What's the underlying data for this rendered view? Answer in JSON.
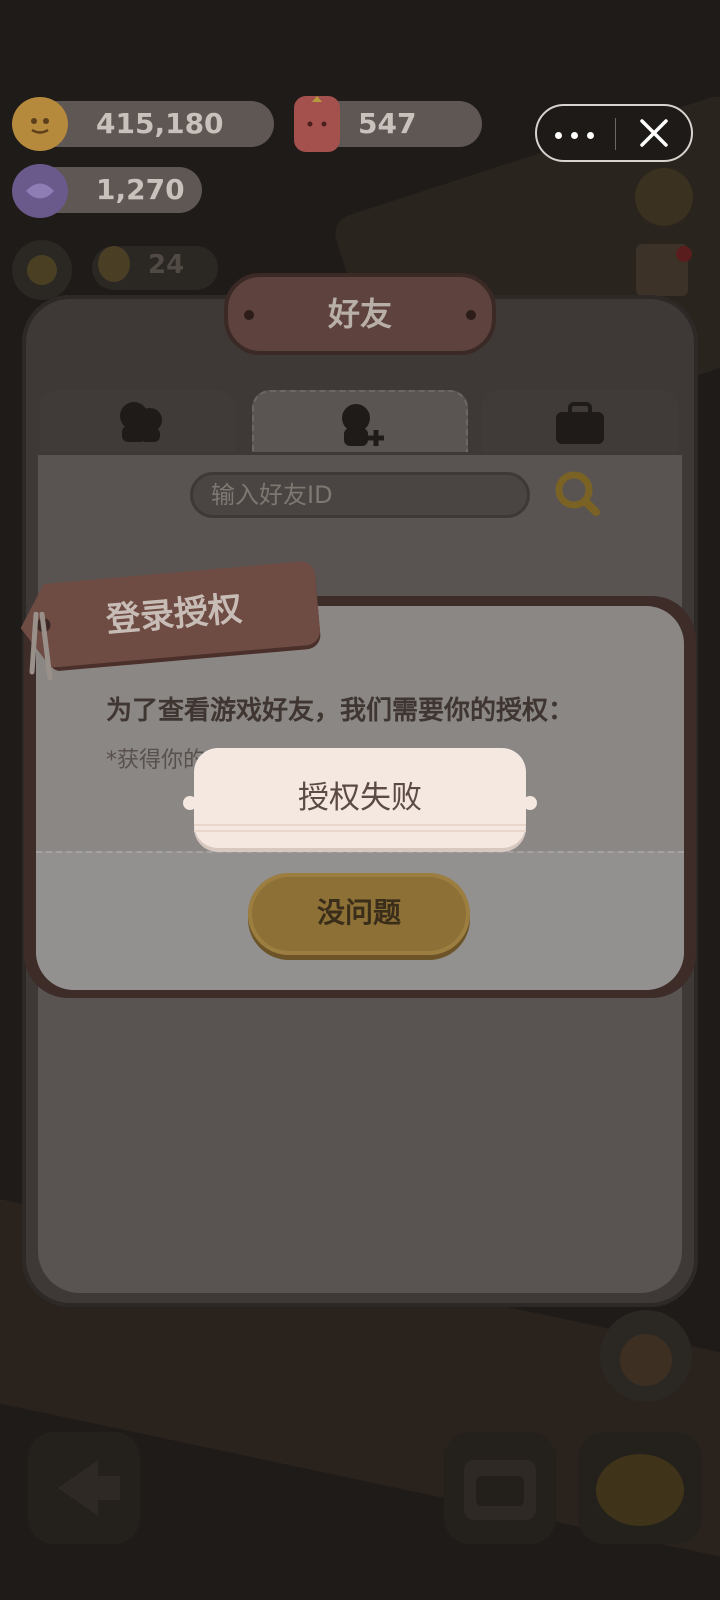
{
  "currency": {
    "coins": "415,180",
    "candy": "547",
    "gems": "1,270",
    "ducks": "24"
  },
  "colors": {
    "accent_gold": "#8d7036",
    "panel": "#3e3936",
    "toast_bg": "#f4e8e1",
    "tag_brown": "#6e4b43"
  },
  "friends_panel": {
    "title": "好友",
    "tabs": [
      {
        "name": "friends-list",
        "icon": "friends-icon"
      },
      {
        "name": "add-friend",
        "icon": "add-friend-icon"
      },
      {
        "name": "inventory",
        "icon": "briefcase-icon"
      }
    ],
    "active_tab": 1,
    "search_placeholder": "输入好友ID",
    "search_icon": "magnifier-icon"
  },
  "login_dialog": {
    "title": "登录授权",
    "message": "为了查看游戏好友，我们需要你的授权：",
    "sub_message": "*获得你的",
    "confirm_label": "没问题"
  },
  "toast": {
    "message": "授权失败"
  },
  "system_menu": {
    "more_icon": "more-dots-icon",
    "close_icon": "close-icon"
  }
}
